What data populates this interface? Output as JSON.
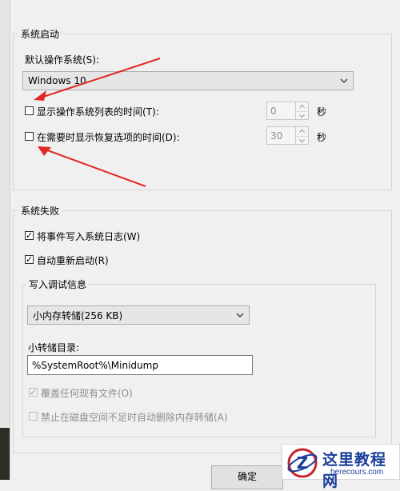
{
  "startup": {
    "group_label": "系统启动",
    "default_os_label": "默认操作系统(S):",
    "default_os_value": "Windows 10",
    "show_os_list": {
      "checked": false,
      "label": "显示操作系统列表的时间(T):",
      "value": "0",
      "unit": "秒"
    },
    "show_recovery": {
      "checked": false,
      "label": "在需要时显示恢复选项的时间(D):",
      "value": "30",
      "unit": "秒"
    }
  },
  "failure": {
    "group_label": "系统失败",
    "write_event": {
      "checked": true,
      "label": "将事件写入系统日志(W)"
    },
    "auto_restart": {
      "checked": true,
      "label": "自动重新启动(R)"
    },
    "debug": {
      "group_label": "写入调试信息",
      "dump_type": "小内存转储(256 KB)",
      "dir_label": "小转储目录:",
      "dir_value": "%SystemRoot%\\Minidump",
      "overwrite": {
        "checked": true,
        "disabled": true,
        "label": "覆盖任何现有文件(O)"
      },
      "disable_auto_delete": {
        "checked": false,
        "disabled": true,
        "label": "禁止在磁盘空间不足时自动删除内存转储(A)"
      }
    }
  },
  "footer": {
    "ok_label": "确定"
  },
  "watermark": {
    "title": "这里教程网",
    "subtitle": "herecours.com",
    "logo_letter": "Z"
  },
  "colors": {
    "arrow": "#e02a24",
    "watermark_blue": "#1a3f9a"
  }
}
